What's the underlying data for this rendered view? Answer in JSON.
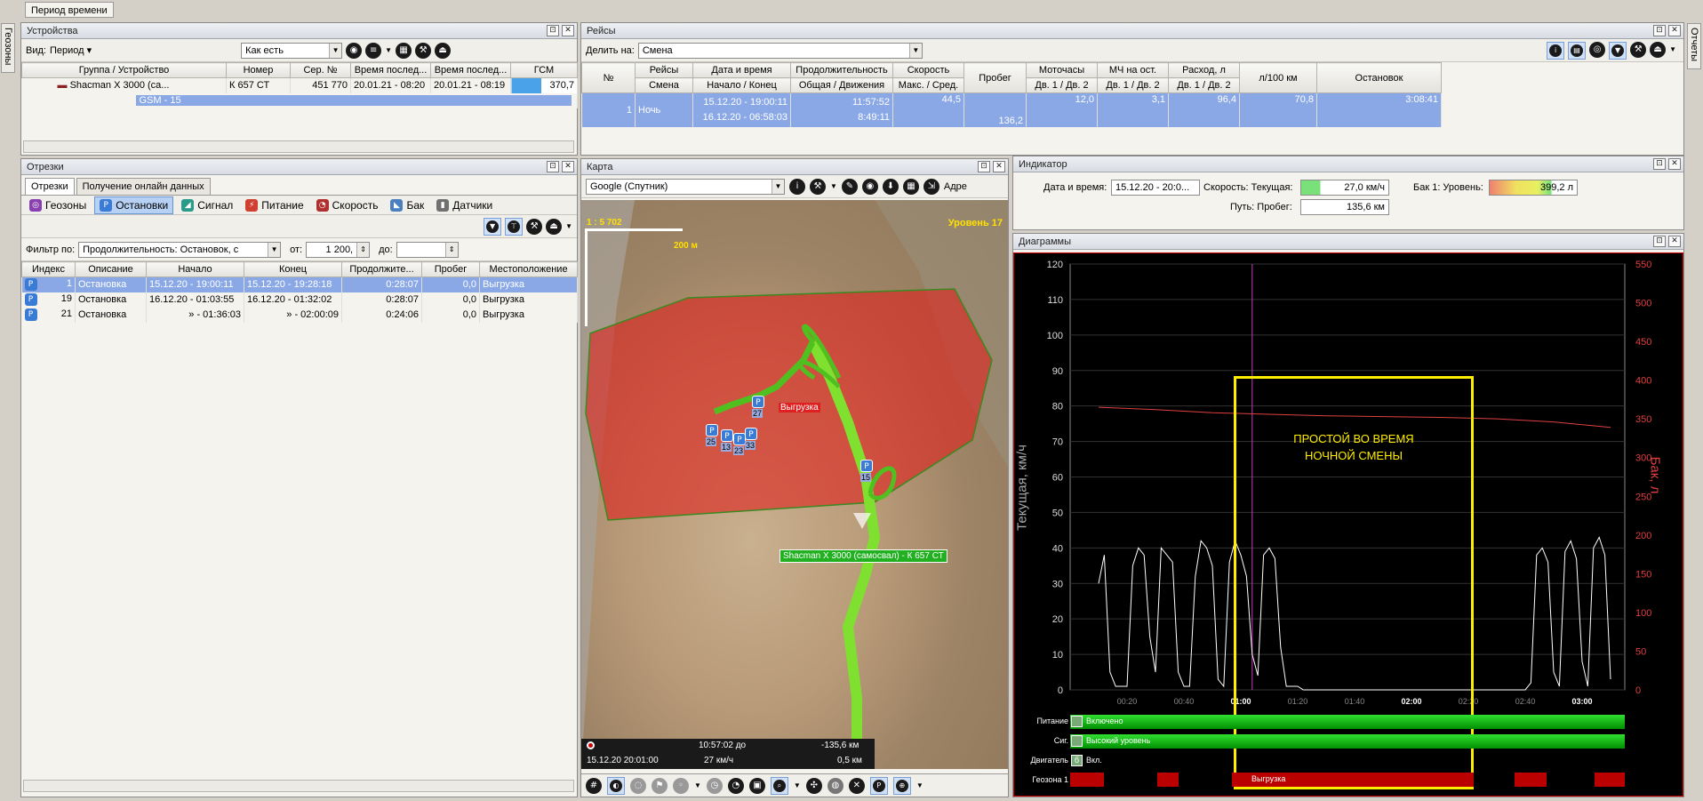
{
  "top_tab": "Период времени",
  "left_vtab": "Геозоны",
  "right_vtab": "Отчеты",
  "devices": {
    "title": "Устройства",
    "view_label": "Вид:",
    "period_label": "Период",
    "as_is": "Как есть",
    "columns": [
      "Группа / Устройство",
      "Номер",
      "Сер. №",
      "Время послед...",
      "Время послед...",
      "ГСМ"
    ],
    "device": {
      "name": "Shacman X 3000 (са...",
      "number": "К 657 СТ",
      "serial": "451 770",
      "time1": "20.01.21 - 08:20",
      "time2": "20.01.21 - 08:19",
      "fuel": "370,7"
    },
    "subrow": "GSM - 15"
  },
  "trips": {
    "title": "Рейсы",
    "split_label": "Делить на:",
    "split_value": "Смена",
    "headers_top": [
      "№",
      "Рейсы",
      "Дата и время",
      "Продолжительность",
      "Скорость",
      "Пробег",
      "Моточасы",
      "МЧ на ост.",
      "Расход, л",
      "л/100 км",
      "Остановок"
    ],
    "headers_sub": [
      "Смена",
      "Начало / Конец",
      "Общая / Движения",
      "Макс. / Сред.",
      "Дв. 1 / Дв. 2",
      "Дв. 1 / Дв. 2",
      "Дв. 1 / Дв. 2"
    ],
    "row": {
      "num": "1",
      "shift": "Ночь",
      "start": "15.12.20 - 19:00:11",
      "end": "16.12.20 - 06:58:03",
      "total": "11:57:52",
      "moving": "8:49:11",
      "speed": "44,5",
      "mileage": "136,2",
      "motohours": "12,0",
      "mh_stop": "3,1",
      "consumption": "96,4",
      "per100": "70,8",
      "stops": "3:08:41"
    }
  },
  "segments": {
    "title": "Отрезки",
    "tabs": [
      "Отрезки",
      "Получение онлайн данных"
    ],
    "filters": [
      "Геозоны",
      "Остановки",
      "Сигнал",
      "Питание",
      "Скорость",
      "Бак",
      "Датчики"
    ],
    "filter_by": "Фильтр по:",
    "filter_value": "Продолжительность: Остановок, с",
    "from_label": "от:",
    "from_value": "1 200,",
    "to_label": "до:",
    "columns": [
      "Индекс",
      "Описание",
      "Начало",
      "Конец",
      "Продолжите...",
      "Пробег",
      "Местоположение"
    ],
    "rows": [
      {
        "idx": "1",
        "desc": "Остановка",
        "start": "15.12.20 - 19:00:11",
        "end": "15.12.20 - 19:28:18",
        "dur": "0:28:07",
        "mil": "0,0",
        "loc": "Выгрузка"
      },
      {
        "idx": "19",
        "desc": "Остановка",
        "start": "16.12.20 - 01:03:55",
        "end": "16.12.20 - 01:32:02",
        "dur": "0:28:07",
        "mil": "0,0",
        "loc": "Выгрузка"
      },
      {
        "idx": "21",
        "desc": "Остановка",
        "start": "» - 01:36:03",
        "end": "» - 02:00:09",
        "dur": "0:24:06",
        "mil": "0,0",
        "loc": "Выгрузка"
      }
    ]
  },
  "map": {
    "title": "Карта",
    "provider": "Google (Спутник)",
    "address_label": "Адре",
    "scale": "1 : 5 702",
    "scale_bar": "200 м",
    "level": "Уровень 17",
    "zone_label": "Выгрузка",
    "vehicle_label": "Shacman X 3000 (самосвал) - К 657 СТ",
    "markers": [
      "27",
      "25",
      "13",
      "23",
      "33",
      "15"
    ],
    "status_time": "10:57:02 до",
    "status_dist1": "-135,6 км",
    "status_date": "15.12.20  20:01:00",
    "status_speed": "27 км/ч",
    "status_dist2": "0,5 км"
  },
  "indicator": {
    "title": "Индикатор",
    "datetime_label": "Дата и время:",
    "datetime_value": "15.12.20 - 20:0...",
    "speed_label": "Скорость: Текущая:",
    "speed_value": "27,0 км/ч",
    "tank_label": "Бак 1: Уровень:",
    "tank_value": "399,2 л",
    "path_label": "Путь: Пробег:",
    "path_value": "135,6 км"
  },
  "charts": {
    "title": "Диаграммы",
    "ylabel_left": "Текущая, км/ч",
    "ylabel_right": "Бак, л",
    "annotation_line1": "ПРОСТОЙ ВО ВРЕМЯ",
    "annotation_line2": "НОЧНОЙ СМЕНЫ",
    "bands": [
      {
        "label": "Питание",
        "value": "Включено"
      },
      {
        "label": "Сиг.",
        "value": "Высокий уровень"
      },
      {
        "label": "Двигатель",
        "value": "Вкл."
      },
      {
        "label": "Геозона 1",
        "value": "Выгрузка"
      }
    ],
    "colors": {
      "speed": "#ffffff",
      "tank": "#e04040",
      "highlight": "#ffee00",
      "band": "#00c000",
      "geozone": "#c00000"
    }
  },
  "chart_data": {
    "type": "line",
    "x_ticks": [
      "00:20",
      "00:40",
      "01:00",
      "01:20",
      "01:40",
      "02:00",
      "02:20",
      "02:40",
      "03:00"
    ],
    "y_left_ticks": [
      0,
      10,
      20,
      30,
      40,
      50,
      60,
      70,
      80,
      90,
      100,
      110,
      120
    ],
    "y_right_ticks": [
      0,
      50,
      100,
      150,
      200,
      250,
      300,
      350,
      400,
      450,
      500,
      550
    ],
    "ylim_left": [
      0,
      120
    ],
    "ylim_right": [
      0,
      550
    ],
    "xlabel": "",
    "ylabel": "Текущая, км/ч",
    "series": [
      {
        "name": "Текущая, км/ч",
        "x_minutes": [
          10,
          12,
          14,
          16,
          18,
          20,
          22,
          24,
          26,
          28,
          30,
          32,
          34,
          36,
          38,
          40,
          42,
          44,
          46,
          48,
          50,
          52,
          54,
          56,
          58,
          60,
          62,
          64,
          66,
          68,
          70,
          72,
          74,
          76,
          78,
          80,
          82,
          84,
          86,
          88,
          90,
          92,
          94,
          96,
          98,
          100,
          102,
          104,
          106,
          108,
          110,
          112,
          114,
          116,
          118,
          120,
          122,
          124,
          126,
          128,
          130,
          132,
          134,
          136,
          138,
          140,
          142,
          144,
          146,
          148,
          150,
          152,
          154,
          156,
          158,
          160,
          162,
          164,
          166,
          168,
          170,
          172,
          174,
          176,
          178,
          180,
          182,
          184,
          186,
          188,
          190
        ],
        "values": [
          30,
          38,
          5,
          1,
          1,
          1,
          35,
          40,
          38,
          15,
          5,
          40,
          38,
          36,
          5,
          1,
          1,
          32,
          42,
          40,
          35,
          3,
          1,
          36,
          42,
          38,
          32,
          10,
          4,
          38,
          40,
          37,
          12,
          1,
          1,
          1,
          0,
          0,
          0,
          0,
          0,
          0,
          0,
          0,
          0,
          0,
          0,
          0,
          0,
          0,
          0,
          0,
          0,
          0,
          0,
          0,
          0,
          0,
          0,
          0,
          0,
          0,
          0,
          0,
          0,
          0,
          0,
          0,
          0,
          0,
          0,
          0,
          0,
          0,
          0,
          0,
          2,
          38,
          40,
          36,
          5,
          1,
          39,
          42,
          37,
          8,
          1,
          40,
          43,
          38,
          3
        ]
      },
      {
        "name": "Бак, л",
        "x_minutes": [
          10,
          30,
          50,
          70,
          90,
          110,
          130,
          150,
          170,
          190
        ],
        "values": [
          365,
          362,
          358,
          356,
          354,
          353,
          352,
          350,
          346,
          339
        ]
      }
    ]
  }
}
